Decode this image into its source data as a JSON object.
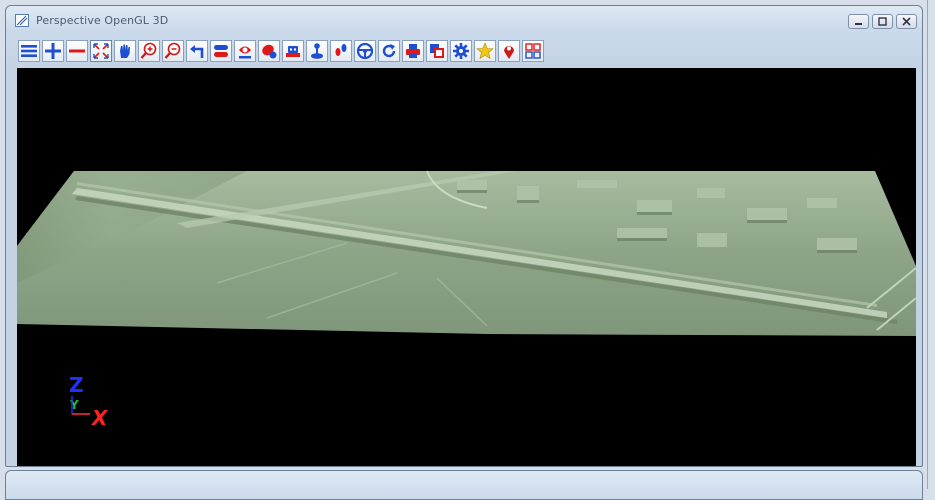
{
  "window": {
    "title": "Perspective OpenGL 3D",
    "controls": [
      "minimize",
      "maximize",
      "close"
    ]
  },
  "toolbar": {
    "buttons": [
      {
        "icon": "menu-icon"
      },
      {
        "icon": "plus-icon"
      },
      {
        "icon": "minus-icon"
      },
      {
        "icon": "fit-extent-icon"
      },
      {
        "icon": "pan-hand-icon"
      },
      {
        "icon": "zoom-in-icon"
      },
      {
        "icon": "zoom-out-icon"
      },
      {
        "icon": "back-arrow-icon"
      },
      {
        "icon": "layers-icon"
      },
      {
        "icon": "eye-view-icon"
      },
      {
        "icon": "palette-icon"
      },
      {
        "icon": "robot-icon"
      },
      {
        "icon": "joystick-icon"
      },
      {
        "icon": "footprints-icon"
      },
      {
        "icon": "steering-wheel-icon"
      },
      {
        "icon": "refresh-icon"
      },
      {
        "icon": "printer-icon"
      },
      {
        "icon": "copy-icon"
      },
      {
        "icon": "gear-icon"
      },
      {
        "icon": "star-icon"
      },
      {
        "icon": "location-pin-icon"
      },
      {
        "icon": "grid-icon"
      }
    ]
  },
  "axis_gizmo": {
    "x": "X",
    "y": "Y",
    "z": "Z"
  },
  "colors": {
    "terrain": "#8fa789",
    "background": "#000000",
    "axis_x": "#ff2020",
    "axis_y": "#20c020",
    "axis_z": "#2030ff"
  }
}
